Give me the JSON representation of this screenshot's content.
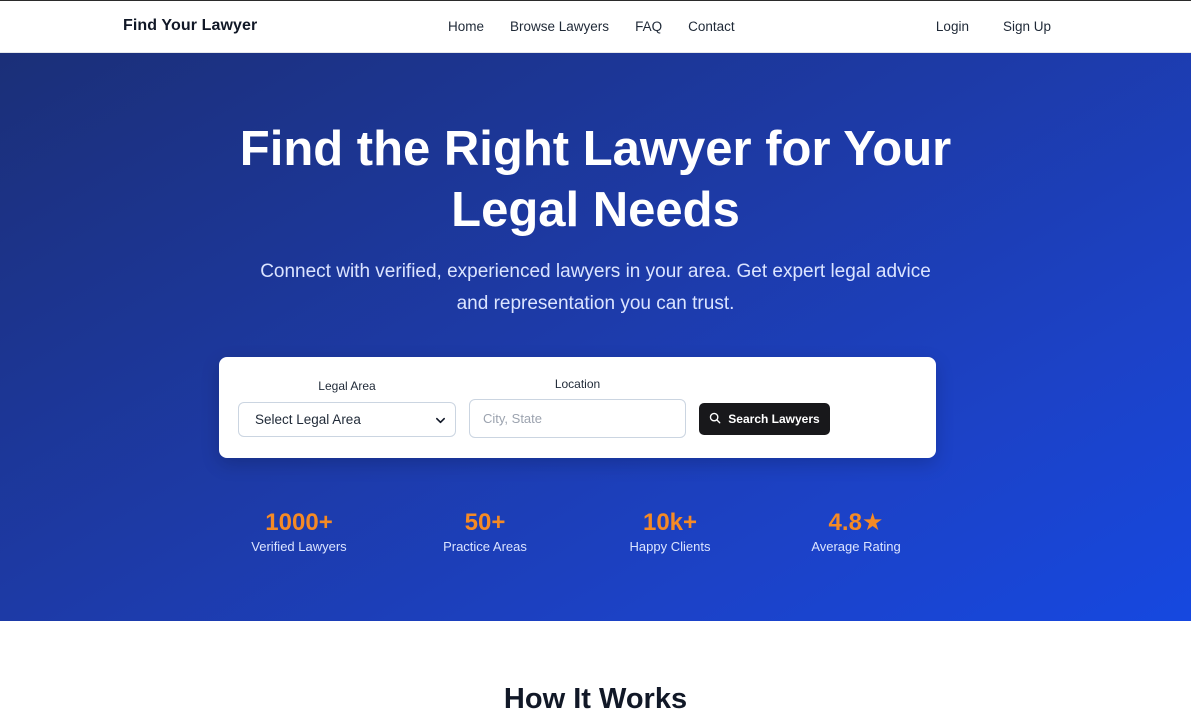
{
  "header": {
    "brand": "Find Your Lawyer",
    "nav": [
      "Home",
      "Browse Lawyers",
      "FAQ",
      "Contact"
    ],
    "login": "Login",
    "signup": "Sign Up"
  },
  "hero": {
    "title": "Find the Right Lawyer for Your Legal Needs",
    "subtitle": "Connect with verified, experienced lawyers in your area. Get expert legal advice and representation you can trust."
  },
  "search": {
    "legal_area_label": "Legal Area",
    "legal_area_value": "Select Legal Area",
    "location_label": "Location",
    "location_placeholder": "City, State",
    "button_label": "Search Lawyers"
  },
  "stats": [
    {
      "value": "1000+",
      "label": "Verified Lawyers"
    },
    {
      "value": "50+",
      "label": "Practice Areas"
    },
    {
      "value": "10k+",
      "label": "Happy Clients"
    },
    {
      "value": "4.8★",
      "label": "Average Rating"
    }
  ],
  "how_it_works": {
    "title": "How It Works"
  },
  "colors": {
    "accent": "#f58a25",
    "hero_start": "#1b2f78",
    "hero_end": "#1648e0",
    "button": "#18181b"
  }
}
